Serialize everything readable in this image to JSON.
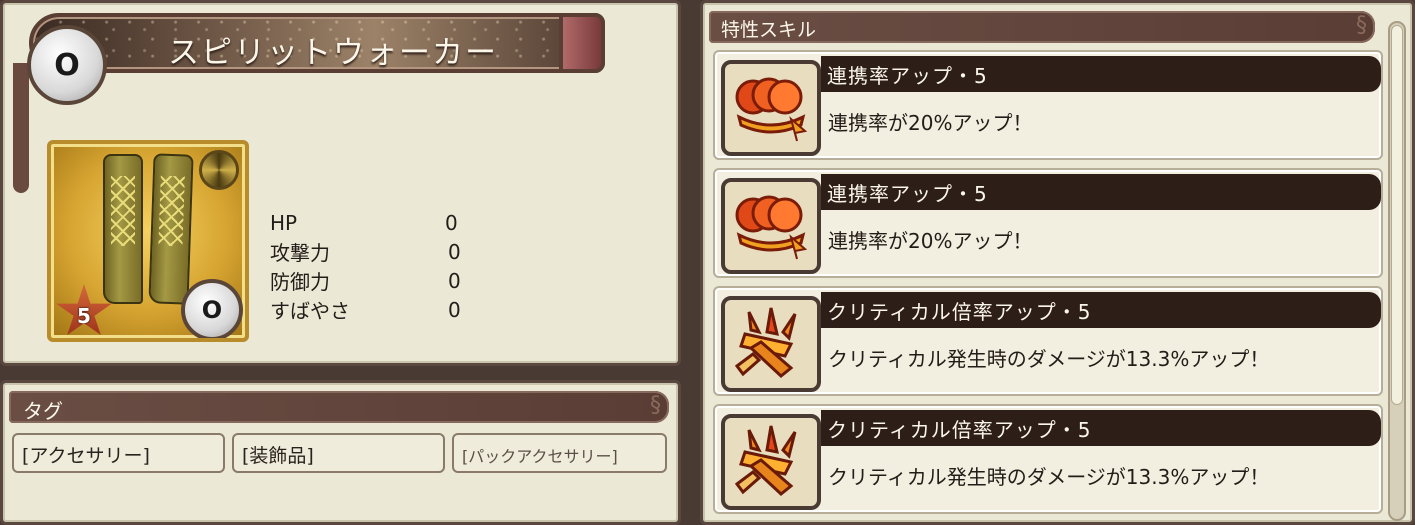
{
  "item": {
    "name": "スピリットウォーカー",
    "category_icon": "ring-icon",
    "rarity": "5",
    "image": "boots-icon"
  },
  "stats": [
    {
      "label": "HP",
      "value": "0"
    },
    {
      "label": "攻撃力",
      "value": "0"
    },
    {
      "label": "防御力",
      "value": "0"
    },
    {
      "label": "すばやさ",
      "value": "0"
    }
  ],
  "tags": {
    "title": "タグ",
    "items": [
      "[アクセサリー]",
      "[装飾品]",
      "[パックアクセサリー]"
    ]
  },
  "skills": {
    "title": "特性スキル",
    "items": [
      {
        "name": "連携率アップ・5",
        "desc": "連携率が20%アップ！",
        "icon": "chain-rate-icon"
      },
      {
        "name": "連携率アップ・5",
        "desc": "連携率が20%アップ！",
        "icon": "chain-rate-icon"
      },
      {
        "name": "クリティカル倍率アップ・5",
        "desc": "クリティカル発生時のダメージが13.3%アップ！",
        "icon": "critical-icon"
      },
      {
        "name": "クリティカル倍率アップ・5",
        "desc": "クリティカル発生時のダメージが13.3%アップ！",
        "icon": "critical-icon"
      }
    ]
  },
  "colors": {
    "panel_bg": "#ebe8d6",
    "header_bg": "#5a3e36",
    "accent_gold": "#d6a431",
    "name_bar": "#2e1e18"
  }
}
